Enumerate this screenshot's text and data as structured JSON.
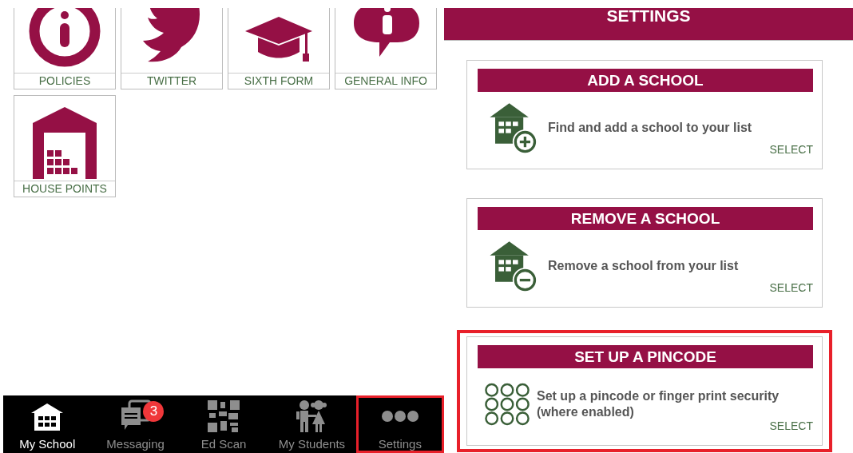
{
  "tiles": [
    {
      "label": "POLICIES",
      "kind": "info"
    },
    {
      "label": "TWITTER",
      "kind": "bird"
    },
    {
      "label": "SIXTH FORM",
      "kind": "cap"
    },
    {
      "label": "GENERAL INFO",
      "kind": "bubble"
    },
    {
      "label": "HOUSE POINTS",
      "kind": "warehouse"
    }
  ],
  "tab_bar": [
    {
      "label": "My School",
      "kind": "school",
      "selected": true,
      "highlighted": false
    },
    {
      "label": "Messaging",
      "kind": "messages",
      "selected": false,
      "highlighted": false,
      "badge": "3"
    },
    {
      "label": "Ed Scan",
      "kind": "qr",
      "selected": false,
      "highlighted": false
    },
    {
      "label": "My Students",
      "kind": "students",
      "selected": false,
      "highlighted": false
    },
    {
      "label": "Settings",
      "kind": "more",
      "selected": false,
      "highlighted": true
    }
  ],
  "header": {
    "title": "SETTINGS"
  },
  "cards": [
    {
      "title": "ADD A SCHOOL",
      "description": "Find and add a school to your list",
      "action": "SELECT",
      "kind": "add",
      "highlighted": false
    },
    {
      "title": "REMOVE A SCHOOL",
      "description": "Remove a school from your list",
      "action": "SELECT",
      "kind": "remove",
      "highlighted": false
    },
    {
      "title": "SET UP A PINCODE",
      "description": "Set up a pincode or finger print security (where enabled)",
      "action": "SELECT",
      "kind": "pin",
      "highlighted": true
    }
  ]
}
